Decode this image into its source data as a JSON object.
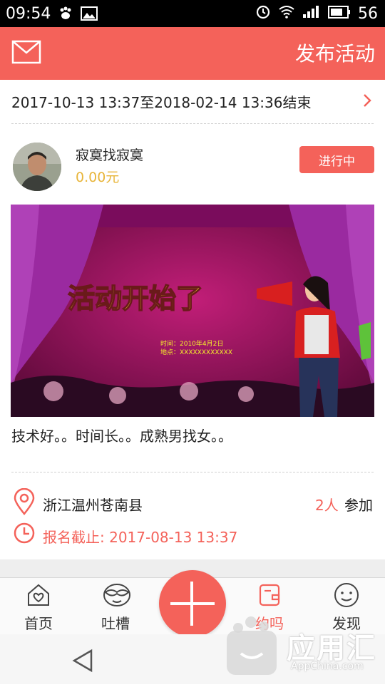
{
  "status_bar": {
    "time": "09:54",
    "battery": "56"
  },
  "header": {
    "publish_label": "发布活动"
  },
  "event": {
    "date_range": "2017-10-13 13:37至2018-02-14 13:36结束",
    "organizer": "寂寞找寂寞",
    "price": "0.00元",
    "status": "进行中",
    "banner": {
      "title": "活动开始了",
      "time_line": "时间：2010年4月2日",
      "place_line": "地点：XXXXXXXXXXXX"
    },
    "description": "技术好。。时间长。。成熟男找女。。",
    "location": "浙江温州苍南县",
    "participants_count": "2人",
    "participants_label": "参加",
    "deadline": "报名截止: 2017-08-13 13:37"
  },
  "tabs": [
    {
      "label": "首页",
      "icon": "home-heart-icon",
      "active": false
    },
    {
      "label": "吐槽",
      "icon": "mask-face-icon",
      "active": false
    },
    {
      "label": "约吗",
      "icon": "wallet-icon",
      "active": true
    },
    {
      "label": "发现",
      "icon": "smiley-icon",
      "active": false
    }
  ],
  "watermark": {
    "text": "应用汇",
    "sub": "AppChina.com"
  },
  "colors": {
    "accent": "#f4625a",
    "price": "#e8b53a",
    "banner_bg": "#b0186a",
    "banner_title": "#f5ef2a"
  }
}
